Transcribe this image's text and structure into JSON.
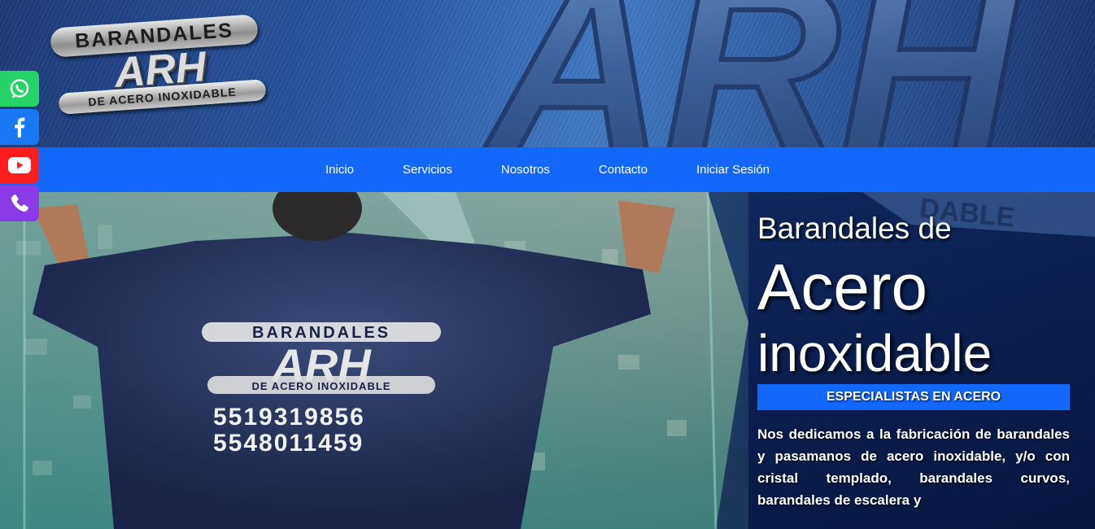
{
  "logo": {
    "top_text": "BARANDALES",
    "middle_text": "ARH",
    "bottom_text": "DE ACERO INOXIDABLE"
  },
  "banner": {
    "big_text": "ARH"
  },
  "nav": {
    "items": [
      {
        "label": "Inicio"
      },
      {
        "label": "Servicios"
      },
      {
        "label": "Nosotros"
      },
      {
        "label": "Contacto"
      },
      {
        "label": "Iniciar Sesión"
      }
    ]
  },
  "social": {
    "items": [
      {
        "icon": "whatsapp-icon",
        "color": "#25d366"
      },
      {
        "icon": "facebook-icon",
        "color": "#1877f2"
      },
      {
        "icon": "youtube-icon",
        "color": "#ff1e1e"
      },
      {
        "icon": "phone-icon",
        "color": "#8a3ae6"
      }
    ]
  },
  "hero": {
    "photo": {
      "shirt_top": "BARANDALES",
      "shirt_logo": "ARH",
      "shirt_bottom": "DE ACERO INOXIDABLE",
      "phone_1": "5519319856",
      "phone_2": "5548011459"
    },
    "line1": "Barandales de",
    "line2": "Acero",
    "line3": "inoxidable",
    "badge": "ESPECIALISTAS EN ACERO",
    "description": "Nos dedicamos a la fabricación de barandales y pasamanos de acero inoxidable, y/o con cristal templado, barandales curvos, barandales de escalera y"
  },
  "colors": {
    "nav_bg": "#1467fb",
    "badge_bg": "#1467fb",
    "banner_bg": "#2a5aa6"
  }
}
